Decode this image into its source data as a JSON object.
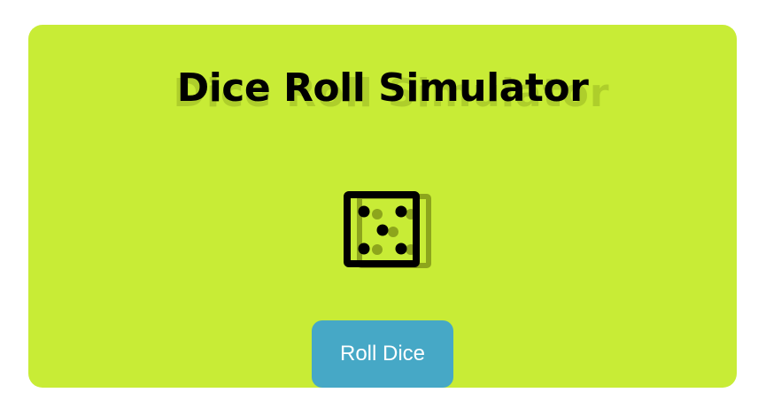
{
  "page": {
    "title": "Dice Roll Simulator"
  },
  "dice": {
    "value": 5,
    "icon": "dice-five-icon"
  },
  "button": {
    "label": "Roll Dice"
  },
  "colors": {
    "card": "#c8ec36",
    "button": "#46a8c6",
    "title": "#000000",
    "title_shadow": "#7f9718",
    "dice": "#000000",
    "dice_shadow": "#8da51c"
  }
}
